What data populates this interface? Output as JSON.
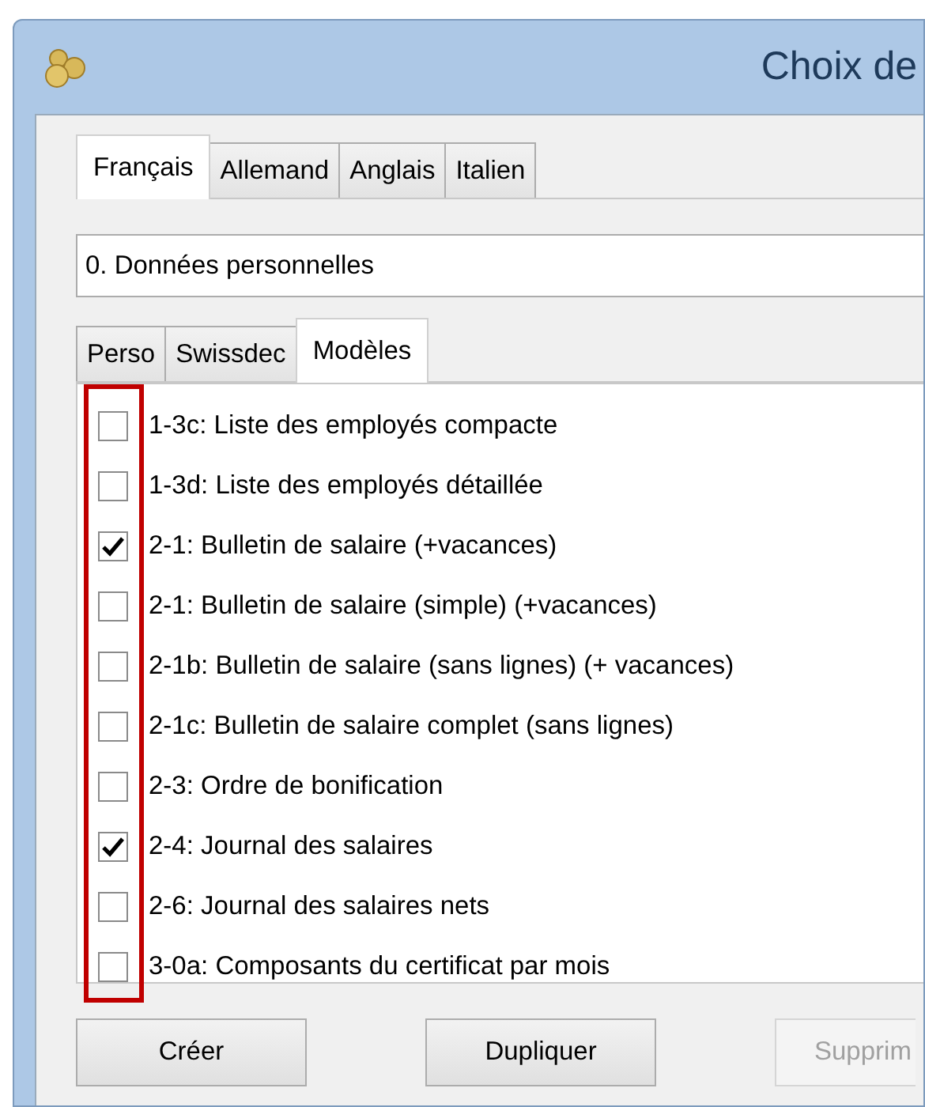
{
  "window": {
    "title": "Choix de"
  },
  "language_tabs": [
    {
      "label": "Français",
      "selected": true
    },
    {
      "label": "Allemand",
      "selected": false
    },
    {
      "label": "Anglais",
      "selected": false
    },
    {
      "label": "Italien",
      "selected": false
    }
  ],
  "category_dropdown": {
    "value": "0. Données personnelles"
  },
  "section_tabs": [
    {
      "label": "Perso",
      "selected": false
    },
    {
      "label": "Swissdec",
      "selected": false
    },
    {
      "label": "Modèles",
      "selected": true
    }
  ],
  "templates": [
    {
      "label": "1-3c: Liste des employés compacte",
      "checked": false
    },
    {
      "label": "1-3d: Liste des employés détaillée",
      "checked": false
    },
    {
      "label": "2-1: Bulletin de salaire (+vacances)",
      "checked": true
    },
    {
      "label": "2-1: Bulletin de salaire (simple) (+vacances)",
      "checked": false
    },
    {
      "label": "2-1b: Bulletin de salaire (sans lignes) (+ vacances)",
      "checked": false
    },
    {
      "label": "2-1c: Bulletin de salaire complet (sans lignes)",
      "checked": false
    },
    {
      "label": "2-3: Ordre de bonification",
      "checked": false
    },
    {
      "label": "2-4: Journal des salaires",
      "checked": true
    },
    {
      "label": "2-6: Journal des salaires nets",
      "checked": false
    },
    {
      "label": "3-0a: Composants du certificat par mois",
      "checked": false
    }
  ],
  "checkbox_column_highlighted": true,
  "buttons": [
    {
      "label": "Créer",
      "disabled": false
    },
    {
      "label": "Dupliquer",
      "disabled": false
    },
    {
      "label": "Supprim",
      "disabled": true
    }
  ]
}
